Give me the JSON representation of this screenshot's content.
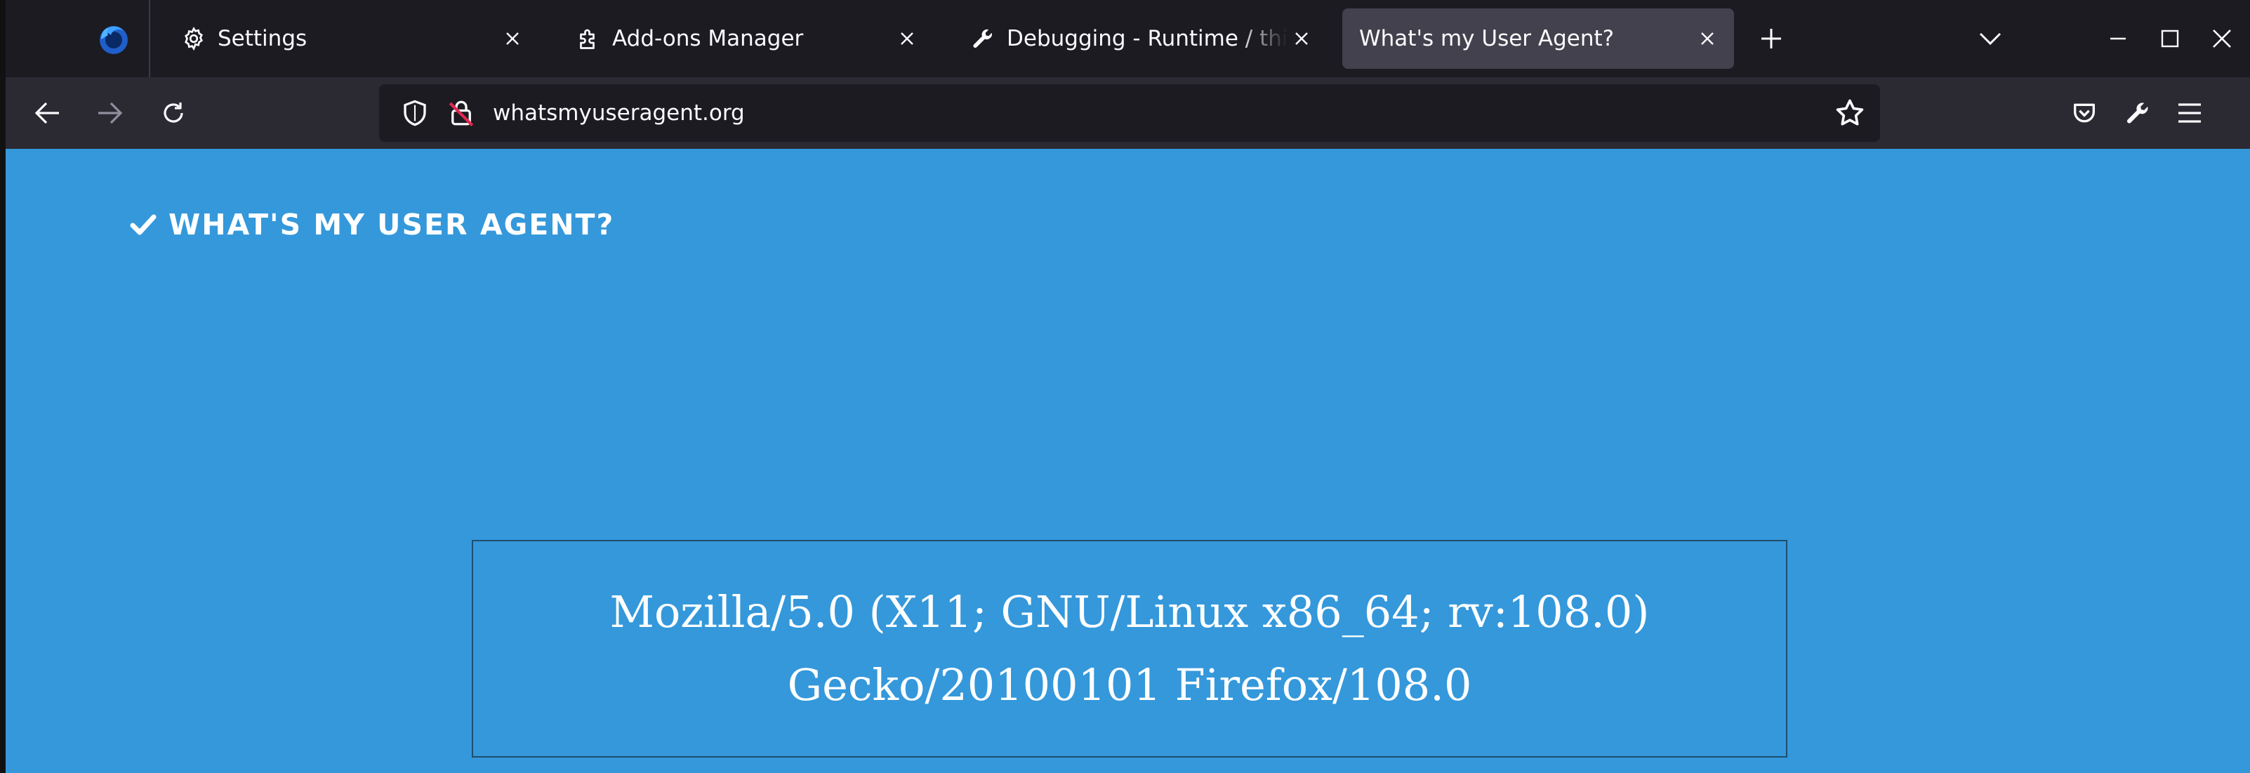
{
  "browser": {
    "tabs": [
      {
        "label": "Settings",
        "icon": "gear-icon",
        "active": false
      },
      {
        "label": "Add-ons Manager",
        "icon": "puzzle-icon",
        "active": false
      },
      {
        "label": "Debugging - Runtime / this-firefox",
        "icon": "wrench-icon",
        "active": false
      },
      {
        "label": "What's my User Agent?",
        "icon": "",
        "active": true
      }
    ],
    "url": "whatsmyuseragent.org",
    "colors": {
      "chrome_bg": "#1c1b22",
      "toolbar_bg": "#2b2a33",
      "active_tab": "#42414d",
      "page_bg": "#3498db"
    }
  },
  "page": {
    "brand": "WHAT'S MY USER AGENT?",
    "user_agent": "Mozilla/5.0 (X11; GNU/Linux x86_64; rv:108.0) Gecko/20100101 Firefox/108.0"
  }
}
